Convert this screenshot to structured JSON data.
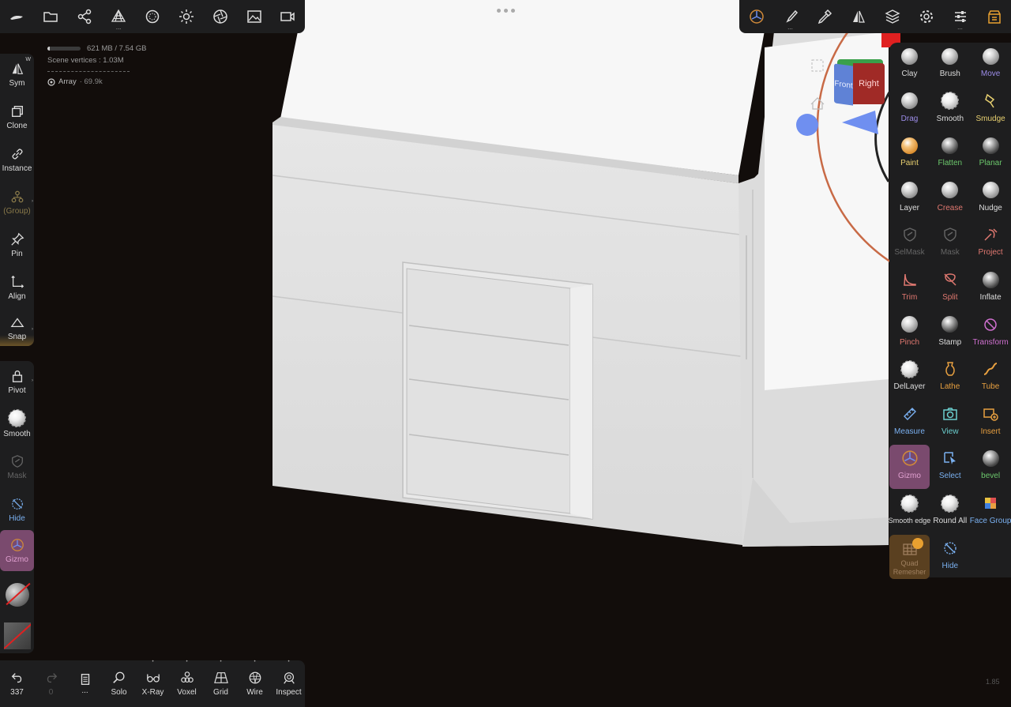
{
  "top_toolbar_left": [
    {
      "name": "logo-icon"
    },
    {
      "name": "folder-icon"
    },
    {
      "name": "scene-tree-icon"
    },
    {
      "name": "multires-icon",
      "has_more": true
    },
    {
      "name": "sphere-material-icon"
    },
    {
      "name": "light-icon"
    },
    {
      "name": "camera-aperture-icon"
    },
    {
      "name": "background-image-icon"
    },
    {
      "name": "video-camera-icon"
    }
  ],
  "top_toolbar_right": [
    {
      "name": "gizmo-mode-icon"
    },
    {
      "name": "brush-stroke-icon",
      "has_more": true
    },
    {
      "name": "eyedropper-icon"
    },
    {
      "name": "symmetry-icon"
    },
    {
      "name": "layers-icon"
    },
    {
      "name": "settings-gear-icon"
    },
    {
      "name": "sliders-icon",
      "has_more": true
    },
    {
      "name": "shop-icon"
    }
  ],
  "stats": {
    "memory": "621 MB / 7.54 GB",
    "memory_fraction": 0.08,
    "vertices": "Scene vertices : 1.03M",
    "array_label": "Array",
    "array_count": "· 69.9k"
  },
  "left_toolbar_top": [
    {
      "key": "sym",
      "label": "Sym",
      "corner": "W",
      "icon": "symmetry-icon"
    },
    {
      "key": "clone",
      "label": "Clone",
      "icon": "clone-icon"
    },
    {
      "key": "instance",
      "label": "Instance",
      "icon": "link-icon"
    },
    {
      "key": "group",
      "label": "(Group)",
      "icon": "group-icon"
    },
    {
      "key": "pin",
      "label": "Pin",
      "icon": "pin-icon"
    },
    {
      "key": "align",
      "label": "Align",
      "icon": "align-icon"
    },
    {
      "key": "snap",
      "label": "Snap",
      "icon": "snap-icon"
    }
  ],
  "left_toolbar_bottom": [
    {
      "key": "pivot",
      "label": "Pivot",
      "icon": "lock-icon"
    },
    {
      "key": "smooth",
      "label": "Smooth",
      "icon": "smooth-sphere-icon"
    },
    {
      "key": "mask",
      "label": "Mask",
      "icon": "mask-shield-icon"
    },
    {
      "key": "hide",
      "label": "Hide",
      "icon": "hide-icon"
    },
    {
      "key": "gizmo",
      "label": "Gizmo",
      "icon": "gizmo-icon"
    }
  ],
  "bottom_toolbar": [
    {
      "key": "undo",
      "label": "337",
      "icon": "undo-icon"
    },
    {
      "key": "redo",
      "label": "0",
      "icon": "redo-icon"
    },
    {
      "key": "history",
      "label": "...",
      "icon": "history-book-icon"
    },
    {
      "key": "solo",
      "label": "Solo",
      "icon": "magnifier-icon"
    },
    {
      "key": "xray",
      "label": "X-Ray",
      "icon": "xray-glasses-icon"
    },
    {
      "key": "voxel",
      "label": "Voxel",
      "icon": "voxel-icon"
    },
    {
      "key": "grid",
      "label": "Grid",
      "icon": "grid-icon"
    },
    {
      "key": "wire",
      "label": "Wire",
      "icon": "wireframe-sphere-icon"
    },
    {
      "key": "inspect",
      "label": "Inspect",
      "icon": "inspect-icon"
    }
  ],
  "tools": [
    {
      "label": "Clay",
      "color": "#dddddd"
    },
    {
      "label": "Brush",
      "color": "#dddddd"
    },
    {
      "label": "Move",
      "color": "#9c8ce8"
    },
    {
      "label": "Drag",
      "color": "#9c8ce8"
    },
    {
      "label": "Smooth",
      "color": "#dddddd"
    },
    {
      "label": "Smudge",
      "color": "#e8d070"
    },
    {
      "label": "Paint",
      "color": "#e8d070"
    },
    {
      "label": "Flatten",
      "color": "#6cc86c"
    },
    {
      "label": "Planar",
      "color": "#6cc86c"
    },
    {
      "label": "Layer",
      "color": "#dddddd"
    },
    {
      "label": "Crease",
      "color": "#e07870"
    },
    {
      "label": "Nudge",
      "color": "#dddddd"
    },
    {
      "label": "SelMask",
      "color": "#666666"
    },
    {
      "label": "Mask",
      "color": "#666666"
    },
    {
      "label": "Project",
      "color": "#e07870"
    },
    {
      "label": "Trim",
      "color": "#e07870"
    },
    {
      "label": "Split",
      "color": "#e07870"
    },
    {
      "label": "Inflate",
      "color": "#dddddd"
    },
    {
      "label": "Pinch",
      "color": "#e07870"
    },
    {
      "label": "Stamp",
      "color": "#dddddd"
    },
    {
      "label": "Transform",
      "color": "#d070d0"
    },
    {
      "label": "DelLayer",
      "color": "#dddddd"
    },
    {
      "label": "Lathe",
      "color": "#e8a040"
    },
    {
      "label": "Tube",
      "color": "#e8a040"
    },
    {
      "label": "Measure",
      "color": "#7ab0f0"
    },
    {
      "label": "View",
      "color": "#6ccfcf"
    },
    {
      "label": "Insert",
      "color": "#e8a040"
    },
    {
      "label": "Gizmo",
      "color": "#e0a0d0"
    },
    {
      "label": "Select",
      "color": "#7ab0f0"
    },
    {
      "label": "bevel",
      "color": "#6cc86c"
    },
    {
      "label": "Smooth edge",
      "color": "#dddddd"
    },
    {
      "label": "Round All",
      "color": "#dddddd"
    },
    {
      "label": "Face Group",
      "color": "#7ab0f0"
    },
    {
      "label": "Quad Remesher",
      "color": "#a08060"
    },
    {
      "label": "Hide",
      "color": "#7ab0f0"
    }
  ],
  "nav_cube": {
    "front": "Front",
    "right": "Right"
  },
  "version": "1.85",
  "colors": {
    "panel": "#1e1e1f",
    "active": "#7a4a6e",
    "background": "#120d0b",
    "model": "#e4e4e4"
  }
}
